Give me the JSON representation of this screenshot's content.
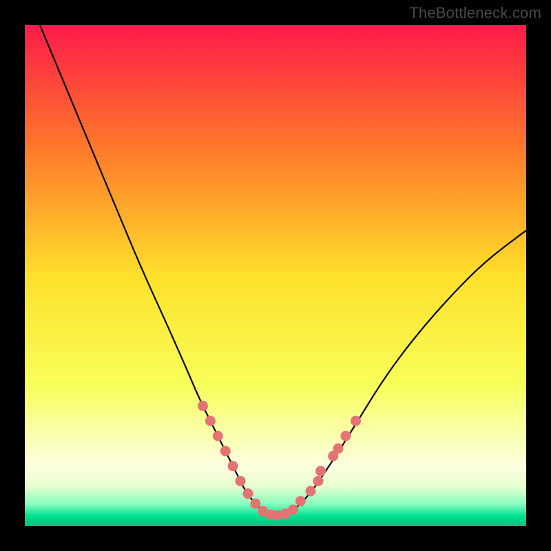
{
  "watermark": "TheBottleneck.com",
  "chart_data": {
    "type": "line",
    "title": "",
    "xlabel": "",
    "ylabel": "",
    "xlim": [
      0,
      100
    ],
    "ylim": [
      0,
      100
    ],
    "gradient_stops": [
      {
        "offset": 0,
        "color": "#ff1a4a"
      },
      {
        "offset": 0.25,
        "color": "#ff7a2a"
      },
      {
        "offset": 0.5,
        "color": "#ffe02a"
      },
      {
        "offset": 0.72,
        "color": "#f7ff5a"
      },
      {
        "offset": 0.82,
        "color": "#faffb0"
      },
      {
        "offset": 0.88,
        "color": "#fdffe0"
      },
      {
        "offset": 0.92,
        "color": "#e8ffd0"
      },
      {
        "offset": 0.955,
        "color": "#8affc0"
      },
      {
        "offset": 0.98,
        "color": "#00e090"
      },
      {
        "offset": 1.0,
        "color": "#00c080"
      }
    ],
    "series": [
      {
        "name": "curve",
        "x": [
          3,
          8,
          13,
          18,
          23,
          28,
          32,
          35,
          38,
          40.5,
          42.5,
          44,
          45.5,
          47,
          48.5,
          50,
          52,
          54,
          56,
          58,
          60,
          63,
          67,
          72,
          78,
          85,
          92,
          100
        ],
        "y": [
          100,
          88,
          76,
          64,
          52,
          41,
          32,
          25,
          19,
          14,
          10,
          7,
          5,
          3.5,
          2.5,
          2,
          2.5,
          3.5,
          5.5,
          8,
          11,
          15.5,
          22,
          30,
          38,
          46,
          53,
          59
        ]
      }
    ],
    "markers": [
      {
        "x": 35.5,
        "y": 24
      },
      {
        "x": 37,
        "y": 21
      },
      {
        "x": 38.5,
        "y": 18
      },
      {
        "x": 40,
        "y": 15
      },
      {
        "x": 41.5,
        "y": 12
      },
      {
        "x": 43,
        "y": 9
      },
      {
        "x": 44.5,
        "y": 6.5
      },
      {
        "x": 46,
        "y": 4.5
      },
      {
        "x": 47.5,
        "y": 3
      },
      {
        "x": 49,
        "y": 2.3
      },
      {
        "x": 50.5,
        "y": 2.2
      },
      {
        "x": 52,
        "y": 2.5
      },
      {
        "x": 53.5,
        "y": 3.3
      },
      {
        "x": 55,
        "y": 5
      },
      {
        "x": 57,
        "y": 7
      },
      {
        "x": 58.5,
        "y": 9
      },
      {
        "x": 59,
        "y": 11
      },
      {
        "x": 61.5,
        "y": 14
      },
      {
        "x": 62.5,
        "y": 15.5
      },
      {
        "x": 64,
        "y": 18
      },
      {
        "x": 66,
        "y": 21
      }
    ],
    "marker_color": "#e57373",
    "curve_color": "#000000"
  }
}
